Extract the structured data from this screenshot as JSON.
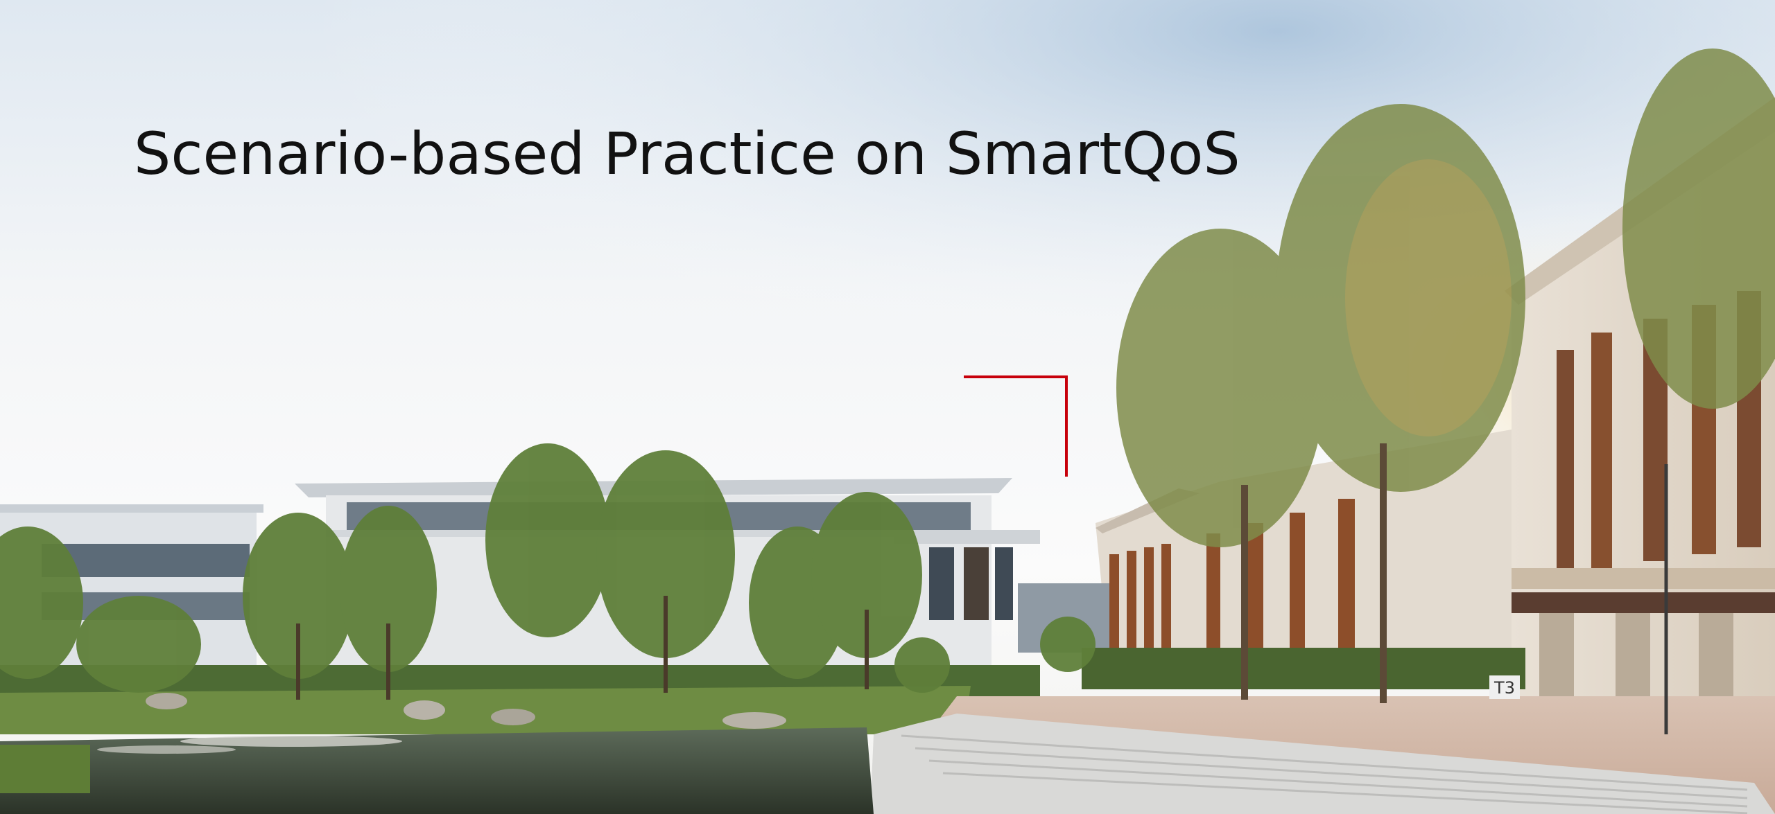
{
  "slide": {
    "title": "Scenario-based Practice on SmartQoS",
    "accent_color": "#c7000b"
  },
  "scene": {
    "building_sign": "T3"
  }
}
